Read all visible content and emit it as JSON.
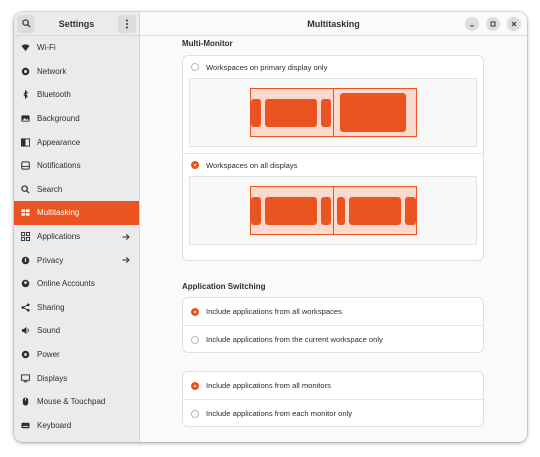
{
  "sidebar": {
    "title": "Settings",
    "items": [
      {
        "label": "Wi-Fi",
        "icon": "wifi-icon",
        "active": false,
        "arrow": false
      },
      {
        "label": "Network",
        "icon": "network-icon",
        "active": false,
        "arrow": false
      },
      {
        "label": "Bluetooth",
        "icon": "bluetooth-icon",
        "active": false,
        "arrow": false
      },
      {
        "label": "Background",
        "icon": "background-icon",
        "active": false,
        "arrow": false
      },
      {
        "label": "Appearance",
        "icon": "appearance-icon",
        "active": false,
        "arrow": false
      },
      {
        "label": "Notifications",
        "icon": "notifications-icon",
        "active": false,
        "arrow": false
      },
      {
        "label": "Search",
        "icon": "search-icon",
        "active": false,
        "arrow": false
      },
      {
        "label": "Multitasking",
        "icon": "multitasking-icon",
        "active": true,
        "arrow": false
      },
      {
        "label": "Applications",
        "icon": "applications-icon",
        "active": false,
        "arrow": true
      },
      {
        "label": "Privacy",
        "icon": "privacy-icon",
        "active": false,
        "arrow": true
      },
      {
        "label": "Online Accounts",
        "icon": "online-accounts-icon",
        "active": false,
        "arrow": false
      },
      {
        "label": "Sharing",
        "icon": "sharing-icon",
        "active": false,
        "arrow": false
      },
      {
        "label": "Sound",
        "icon": "sound-icon",
        "active": false,
        "arrow": false
      },
      {
        "label": "Power",
        "icon": "power-icon",
        "active": false,
        "arrow": false
      },
      {
        "label": "Displays",
        "icon": "displays-icon",
        "active": false,
        "arrow": false
      },
      {
        "label": "Mouse & Touchpad",
        "icon": "mouse-icon",
        "active": false,
        "arrow": false
      },
      {
        "label": "Keyboard",
        "icon": "keyboard-icon",
        "active": false,
        "arrow": false
      }
    ]
  },
  "header": {
    "title": "Multitasking"
  },
  "multi_monitor": {
    "title": "Multi-Monitor",
    "options": [
      {
        "label": "Workspaces on primary display only",
        "selected": false
      },
      {
        "label": "Workspaces on all displays",
        "selected": true
      }
    ]
  },
  "app_switching": {
    "title": "Application Switching",
    "workspace_options": [
      {
        "label": "Include applications from all workspaces",
        "selected": true
      },
      {
        "label": "Include applications from the current workspace only",
        "selected": false
      }
    ],
    "monitor_options": [
      {
        "label": "Include applications from all monitors",
        "selected": true
      },
      {
        "label": "Include applications from each monitor only",
        "selected": false
      }
    ]
  },
  "colors": {
    "accent": "#e95420",
    "accent_light": "#fbd9cc"
  }
}
